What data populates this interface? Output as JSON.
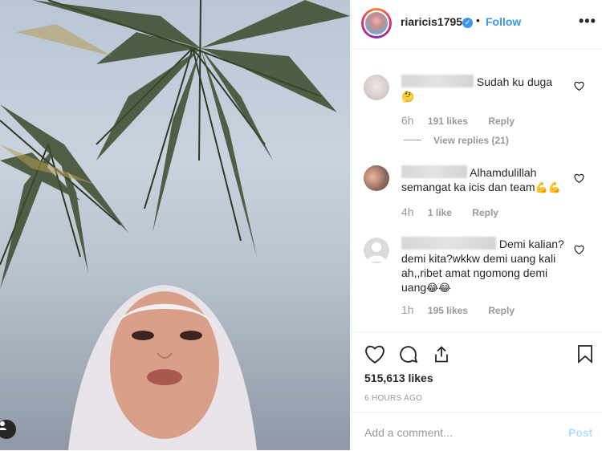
{
  "header": {
    "username": "riaricis1795",
    "follow_label": "Follow",
    "more_label": "•••"
  },
  "comments": [
    {
      "text": "Sudah ku duga",
      "emoji": "🤔",
      "time": "6h",
      "likes": "191 likes",
      "reply_label": "Reply",
      "view_replies": "View replies (21)"
    },
    {
      "text_line1": "Alhamdulillah",
      "text_line2": "semangat ka icis dan team",
      "emoji": "💪💪",
      "time": "4h",
      "likes": "1 like",
      "reply_label": "Reply"
    },
    {
      "text_line1": "Demi kalian?",
      "text_line2": "demi kita?wkkw demi uang kali",
      "text_line3": "ah,,ribet amat ngomong demi",
      "text_line4": "uang",
      "emoji": "😂😂",
      "time": "1h",
      "likes": "195 likes",
      "reply_label": "Reply"
    }
  ],
  "post": {
    "likes": "515,613 likes",
    "time_ago": "6 HOURS AGO"
  },
  "add_comment": {
    "placeholder": "Add a comment...",
    "post_label": "Post"
  }
}
